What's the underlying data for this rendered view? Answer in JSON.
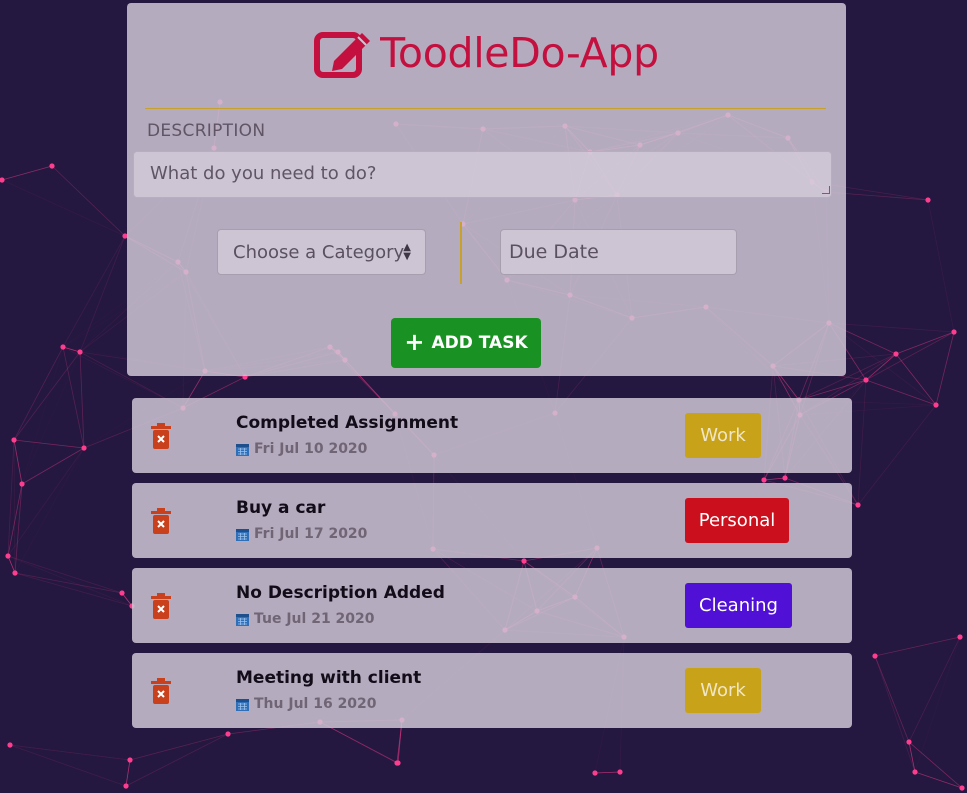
{
  "app": {
    "title": "ToodleDo-App",
    "accent_color": "#c3103e"
  },
  "form": {
    "description_label": "DESCRIPTION",
    "description_placeholder": "What do you need to do?",
    "description_value": "",
    "category_selected": "Choose a Category",
    "due_date_placeholder": "Due Date",
    "add_button_label": "ADD TASK",
    "add_button_icon": "plus-icon"
  },
  "tasks": [
    {
      "title": "Completed Assignment",
      "date": "Fri Jul 10 2020",
      "category": "Work",
      "category_color": "#c8a218",
      "category_text_color": "#f0e6c6"
    },
    {
      "title": "Buy a car",
      "date": "Fri Jul 17 2020",
      "category": "Personal",
      "category_color": "#cc0f1c",
      "category_text_color": "#ffffff"
    },
    {
      "title": "No Description Added",
      "date": "Tue Jul 21 2020",
      "category": "Cleaning",
      "category_color": "#5010d6",
      "category_text_color": "#ffffff"
    },
    {
      "title": "Meeting with client",
      "date": "Thu Jul 16 2020",
      "category": "Work",
      "category_color": "#c8a218",
      "category_text_color": "#f0e6c6"
    }
  ],
  "icons": {
    "title": "edit-icon",
    "delete": "trash-icon",
    "date": "calendar-icon"
  },
  "colors": {
    "background": "#241840",
    "network_line": "#ff3d8f",
    "card": "#cdc4d4",
    "rule": "#c8a12a",
    "add_button": "#1a9123",
    "delete_icon": "#c8401c"
  }
}
